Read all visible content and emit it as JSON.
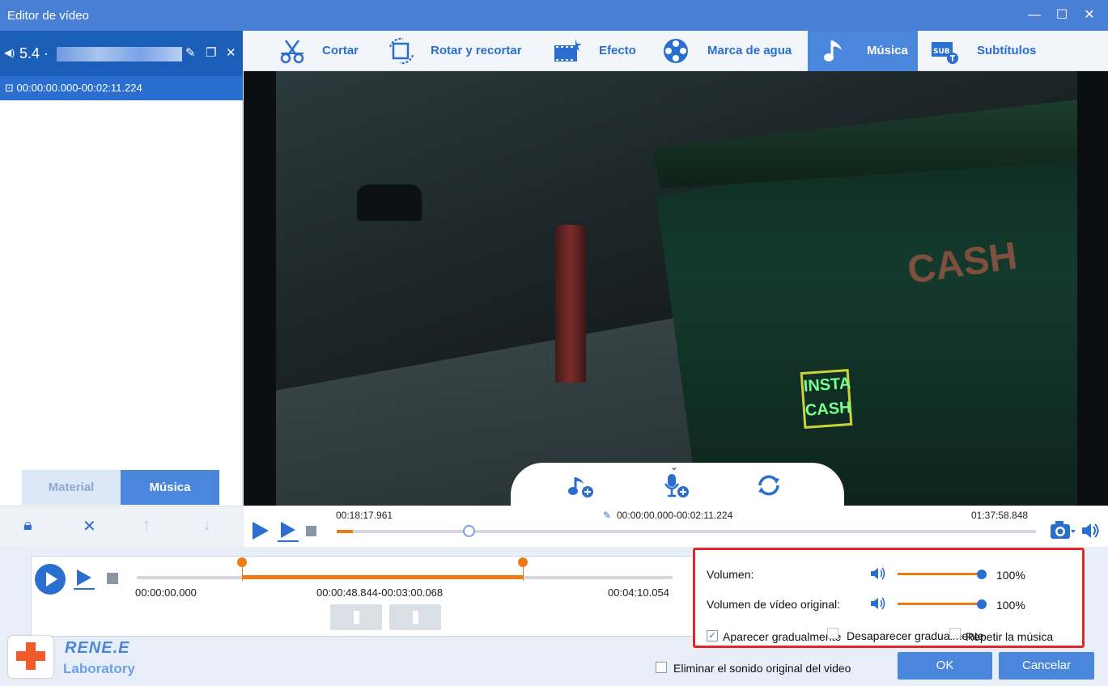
{
  "window": {
    "title": "Editor de vídeo",
    "minimize": "—",
    "maximize": "☐",
    "close": "✕"
  },
  "file": {
    "name": "5.4 ·",
    "volume_icon": "speaker-icon",
    "segment": "00:00:00.000-00:02:11.224"
  },
  "left_tabs": {
    "material": "Material",
    "music": "Música"
  },
  "top_tabs": [
    {
      "label": "Cortar",
      "icon": "scissors-icon"
    },
    {
      "label": "Rotar y recortar",
      "icon": "rotate-crop-icon"
    },
    {
      "label": "Efecto",
      "icon": "effect-icon"
    },
    {
      "label": "Marca de agua",
      "icon": "watermark-icon"
    },
    {
      "label": "Música",
      "icon": "music-note-icon",
      "active": true
    },
    {
      "label": "Subtítulos",
      "icon": "subtitles-icon"
    }
  ],
  "timeline": {
    "current": "00:18:17.961",
    "segment": "00:00:00.000-00:02:11.224",
    "total": "01:37:58.848",
    "progress_fraction": 0.19
  },
  "music_track": {
    "start": "00:00:00.000",
    "range": "00:00:48.844-00:03:00.068",
    "end": "00:04:10.054"
  },
  "settings": {
    "volume_label": "Volumen:",
    "volume_value": "100%",
    "original_volume_label": "Volumen de vídeo original:",
    "original_volume_value": "100%",
    "fade_in": "Aparecer gradualmente",
    "fade_out": "Desaparecer gradualmente",
    "repeat": "Repetir la música"
  },
  "footer": {
    "remove_original": "Eliminar el sonido original del video",
    "ok": "OK",
    "cancel": "Cancelar"
  },
  "brand": {
    "name": "RENE.E",
    "sub": "Laboratory"
  },
  "video_text": {
    "neon": "INSTA CASH",
    "sign": "CASH"
  },
  "colors": {
    "accent": "#2a6fcf",
    "titlebar": "#4a7fd6",
    "orange": "#f07b12",
    "highlight": "#e02828"
  }
}
